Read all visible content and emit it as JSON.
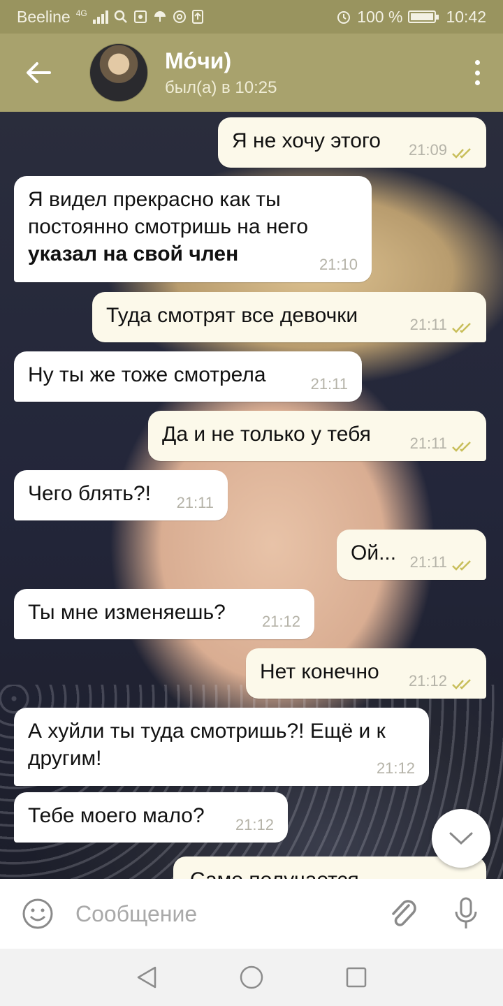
{
  "status_bar": {
    "carrier": "Beeline",
    "network": "4G",
    "battery": "100 %",
    "time": "10:42"
  },
  "header": {
    "name": "Мо́чи)",
    "status": "был(а) в 10:25"
  },
  "messages": [
    {
      "dir": "out",
      "text": "Я не хочу этого",
      "time": "21:09"
    },
    {
      "dir": "in",
      "text": "Я видел прекрасно как ты постоянно смотришь на него",
      "bold": "указал на свой член",
      "time": "21:10"
    },
    {
      "dir": "out",
      "text": "Туда смотрят все девочки",
      "time": "21:11"
    },
    {
      "dir": "in",
      "text": "Ну ты же тоже смотрела",
      "time": "21:11"
    },
    {
      "dir": "out",
      "text": "Да и не только у тебя",
      "time": "21:11"
    },
    {
      "dir": "in",
      "text": "Чего блять?!",
      "time": "21:11"
    },
    {
      "dir": "out",
      "text": "Ой...",
      "time": "21:11"
    },
    {
      "dir": "in",
      "text": "Ты мне изменяешь?",
      "time": "21:12"
    },
    {
      "dir": "out",
      "text": "Нет конечно",
      "time": "21:12"
    },
    {
      "dir": "in",
      "text": "А хуйли ты туда смотришь?! Ещё и к другим!",
      "time": "21:12"
    },
    {
      "dir": "in",
      "text": "Тебе моего мало?",
      "time": "21:12"
    },
    {
      "dir": "out",
      "text": "Само получается",
      "time": ""
    }
  ],
  "input": {
    "placeholder": "Сообщение"
  },
  "colors": {
    "header": "#a8a26d",
    "status_bar": "#99945f",
    "incoming_bubble": "#ffffff",
    "outgoing_bubble": "#fcf9ea",
    "read_ticks": "#c8be5a"
  },
  "icons": {
    "back": "arrow-left-icon",
    "menu": "more-vert-icon",
    "emoji": "smiley-icon",
    "attach": "paperclip-icon",
    "mic": "microphone-icon",
    "scroll": "chevron-down-icon"
  }
}
